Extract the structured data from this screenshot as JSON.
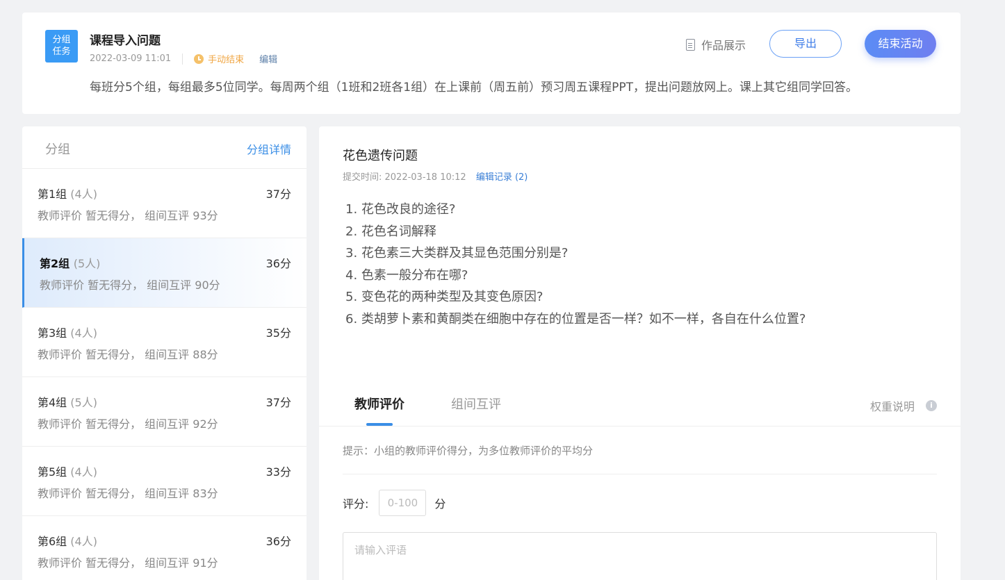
{
  "header": {
    "badge": "分组\n任务",
    "badge_line1": "分组",
    "badge_line2": "任务",
    "title": "课程导入问题",
    "date": "2022-03-09 11:01",
    "end_mode": "手动结束",
    "edit": "编辑",
    "description": "每班分5个组，每组最多5位同学。每周两个组（1班和2班各1组）在上课前（周五前）预习周五课程PPT，提出问题放网上。课上其它组同学回答。",
    "works_label": "作品展示",
    "export_label": "导出",
    "end_label": "结束活动"
  },
  "groups": {
    "title": "分组",
    "detail_link": "分组详情",
    "items": [
      {
        "name": "第1组",
        "count": "(4人)",
        "score": "37分",
        "eval": "教师评价 暂无得分， 组间互评 93分"
      },
      {
        "name": "第2组",
        "count": "(5人)",
        "score": "36分",
        "eval": "教师评价 暂无得分， 组间互评 90分"
      },
      {
        "name": "第3组",
        "count": "(4人)",
        "score": "35分",
        "eval": "教师评价 暂无得分， 组间互评 88分"
      },
      {
        "name": "第4组",
        "count": "(5人)",
        "score": "37分",
        "eval": "教师评价 暂无得分， 组间互评 92分"
      },
      {
        "name": "第5组",
        "count": "(4人)",
        "score": "33分",
        "eval": "教师评价 暂无得分， 组间互评 83分"
      },
      {
        "name": "第6组",
        "count": "(4人)",
        "score": "36分",
        "eval": "教师评价 暂无得分， 组间互评 91分"
      }
    ]
  },
  "submission": {
    "title": "花色遗传问题",
    "submit_time": "提交时间: 2022-03-18 10:12",
    "history": "编辑记录 (2)",
    "questions": [
      "1. 花色改良的途径?",
      "2. 花色名词解释",
      "3. 花色素三大类群及其显色范围分别是?",
      "4. 色素一般分布在哪?",
      "5. 变色花的两种类型及其变色原因?",
      "6. 类胡萝卜素和黄酮类在细胞中存在的位置是否一样？如不一样，各自在什么位置?"
    ]
  },
  "evaluation": {
    "tab_teacher": "教师评价",
    "tab_peer": "组间互评",
    "weight_note": "权重说明",
    "hint": "提示：小组的教师评价得分，为多位教师评价的平均分",
    "score_label": "评分:",
    "score_placeholder": "0-100",
    "score_unit": "分",
    "comment_placeholder": "请输入评语"
  }
}
